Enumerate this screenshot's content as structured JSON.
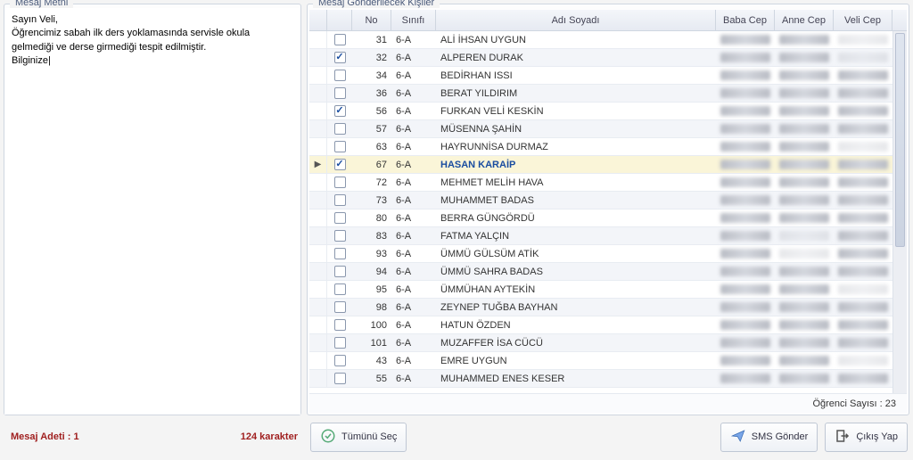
{
  "left_panel_title": "Mesaj Metni",
  "right_panel_title": "Mesaj Gönderilecek Kişiler",
  "message_text": "Sayın Veli,\nÖğrencimiz sabah ilk ders yoklamasında servisle okula gelmediği ve derse girmediği tespit edilmiştir.\nBilginize|",
  "columns": {
    "no": "No",
    "class": "Sınıfı",
    "name": "Adı Soyadı",
    "father": "Baba Cep",
    "mother": "Anne Cep",
    "guardian": "Veli Cep"
  },
  "students": [
    {
      "no": 31,
      "class": "6-A",
      "name": "ALİ İHSAN UYGUN",
      "checked": false,
      "highlight": false,
      "phones": [
        "y",
        "y",
        "n"
      ]
    },
    {
      "no": 32,
      "class": "6-A",
      "name": "ALPEREN DURAK",
      "checked": true,
      "highlight": false,
      "phones": [
        "y",
        "y",
        "n"
      ]
    },
    {
      "no": 34,
      "class": "6-A",
      "name": "BEDİRHAN ISSI",
      "checked": false,
      "highlight": false,
      "phones": [
        "y",
        "y",
        "y"
      ]
    },
    {
      "no": 36,
      "class": "6-A",
      "name": "BERAT YILDIRIM",
      "checked": false,
      "highlight": false,
      "phones": [
        "y",
        "y",
        "y"
      ]
    },
    {
      "no": 56,
      "class": "6-A",
      "name": "FURKAN VELİ KESKİN",
      "checked": true,
      "highlight": false,
      "phones": [
        "y",
        "y",
        "y"
      ]
    },
    {
      "no": 57,
      "class": "6-A",
      "name": "MÜSENNA ŞAHİN",
      "checked": false,
      "highlight": false,
      "phones": [
        "y",
        "y",
        "y"
      ]
    },
    {
      "no": 63,
      "class": "6-A",
      "name": "HAYRUNNİSA DURMAZ",
      "checked": false,
      "highlight": false,
      "phones": [
        "y",
        "y",
        "n"
      ]
    },
    {
      "no": 67,
      "class": "6-A",
      "name": "HASAN KARAİP",
      "checked": true,
      "highlight": true,
      "phones": [
        "y",
        "y",
        "y"
      ]
    },
    {
      "no": 72,
      "class": "6-A",
      "name": "MEHMET MELİH HAVA",
      "checked": false,
      "highlight": false,
      "phones": [
        "y",
        "y",
        "y"
      ]
    },
    {
      "no": 73,
      "class": "6-A",
      "name": "MUHAMMET BADAS",
      "checked": false,
      "highlight": false,
      "phones": [
        "y",
        "y",
        "y"
      ]
    },
    {
      "no": 80,
      "class": "6-A",
      "name": "BERRA GÜNGÖRDÜ",
      "checked": false,
      "highlight": false,
      "phones": [
        "y",
        "y",
        "y"
      ]
    },
    {
      "no": 83,
      "class": "6-A",
      "name": "FATMA YALÇIN",
      "checked": false,
      "highlight": false,
      "phones": [
        "y",
        "n",
        "y"
      ]
    },
    {
      "no": 93,
      "class": "6-A",
      "name": "ÜMMÜ GÜLSÜM ATİK",
      "checked": false,
      "highlight": false,
      "phones": [
        "y",
        "n",
        "y"
      ]
    },
    {
      "no": 94,
      "class": "6-A",
      "name": "ÜMMÜ SAHRA BADAS",
      "checked": false,
      "highlight": false,
      "phones": [
        "y",
        "y",
        "y"
      ]
    },
    {
      "no": 95,
      "class": "6-A",
      "name": "ÜMMÜHAN AYTEKİN",
      "checked": false,
      "highlight": false,
      "phones": [
        "y",
        "y",
        "n"
      ]
    },
    {
      "no": 98,
      "class": "6-A",
      "name": "ZEYNEP TUĞBA BAYHAN",
      "checked": false,
      "highlight": false,
      "phones": [
        "y",
        "y",
        "y"
      ]
    },
    {
      "no": 100,
      "class": "6-A",
      "name": "HATUN ÖZDEN",
      "checked": false,
      "highlight": false,
      "phones": [
        "y",
        "y",
        "y"
      ]
    },
    {
      "no": 101,
      "class": "6-A",
      "name": "MUZAFFER İSA CÜCÜ",
      "checked": false,
      "highlight": false,
      "phones": [
        "y",
        "y",
        "y"
      ]
    },
    {
      "no": 43,
      "class": "6-A",
      "name": "EMRE UYGUN",
      "checked": false,
      "highlight": false,
      "phones": [
        "y",
        "y",
        "n"
      ]
    },
    {
      "no": 55,
      "class": "6-A",
      "name": "MUHAMMED ENES KESER",
      "checked": false,
      "highlight": false,
      "phones": [
        "y",
        "y",
        "y"
      ]
    }
  ],
  "student_count_label": "Öğrenci Sayısı : 23",
  "status": {
    "msg_count": "Mesaj Adeti : 1",
    "char_count": "124 karakter"
  },
  "buttons": {
    "select_all": "Tümünü Seç",
    "send_sms": "SMS Gönder",
    "exit": "Çıkış Yap"
  }
}
